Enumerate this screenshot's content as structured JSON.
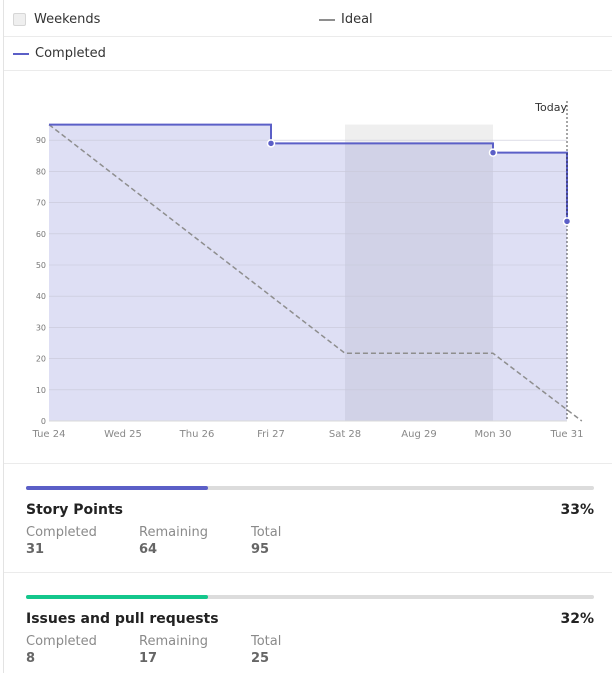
{
  "legend": {
    "weekends": "Weekends",
    "ideal": "Ideal",
    "completed": "Completed"
  },
  "colors": {
    "completed": "#5b5fc7",
    "completed_fill": "#dedff1",
    "weekend": "#efefef",
    "ideal": "#8e8e8e",
    "story_bar": "#5b5fc7",
    "issues_bar": "#14c78c"
  },
  "chart_data": {
    "type": "line",
    "x_labels": [
      "Tue 24",
      "Wed 25",
      "Thu 26",
      "Fri 27",
      "Sat 28",
      "Aug 29",
      "Mon 30",
      "Tue 31"
    ],
    "y_ticks": [
      0,
      10,
      20,
      30,
      40,
      50,
      60,
      70,
      80,
      90
    ],
    "ylim": [
      0,
      95
    ],
    "today_label": "Today",
    "today_index": 7,
    "weekend_range": [
      4,
      6
    ],
    "series": [
      {
        "name": "Ideal",
        "style": "dashed",
        "points": [
          [
            0,
            95
          ],
          [
            4,
            21.7
          ],
          [
            6,
            21.7
          ],
          [
            7.2,
            0
          ]
        ]
      },
      {
        "name": "Completed",
        "style": "step",
        "points": [
          [
            0,
            95
          ],
          [
            3,
            89
          ],
          [
            6,
            86
          ],
          [
            7,
            64
          ]
        ],
        "markers": [
          [
            3,
            89
          ],
          [
            6,
            86
          ],
          [
            7,
            64
          ]
        ]
      }
    ]
  },
  "stats": [
    {
      "title": "Story Points",
      "percent": "33%",
      "progress": 0.32,
      "completed_label": "Completed",
      "completed": "31",
      "remaining_label": "Remaining",
      "remaining": "64",
      "total_label": "Total",
      "total": "95"
    },
    {
      "title": "Issues and pull requests",
      "percent": "32%",
      "progress": 0.32,
      "completed_label": "Completed",
      "completed": "8",
      "remaining_label": "Remaining",
      "remaining": "17",
      "total_label": "Total",
      "total": "25"
    }
  ]
}
